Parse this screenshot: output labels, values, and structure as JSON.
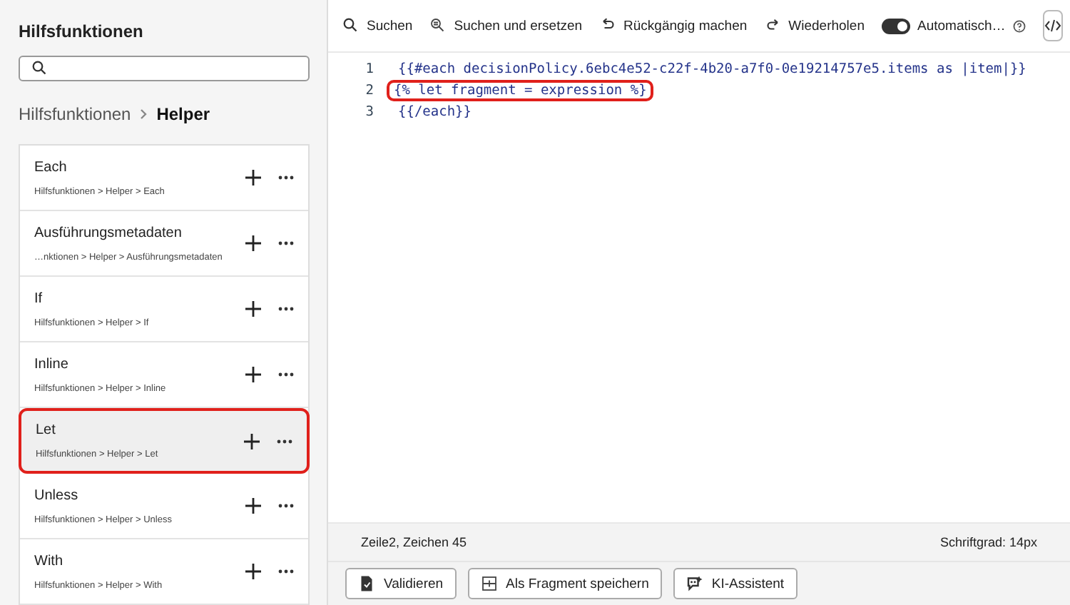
{
  "sidebar": {
    "title": "Hilfsfunktionen",
    "breadcrumb": [
      {
        "label": "Hilfsfunktionen",
        "current": false
      },
      {
        "label": "Helper",
        "current": true
      }
    ],
    "items": [
      {
        "name": "Each",
        "path": "Hilfsfunktionen > Helper > Each",
        "selected": false,
        "highlighted": false
      },
      {
        "name": "Ausführungsmetadaten",
        "path": "…nktionen > Helper > Ausführungsmetadaten",
        "selected": false,
        "highlighted": false
      },
      {
        "name": "If",
        "path": "Hilfsfunktionen > Helper > If",
        "selected": false,
        "highlighted": false
      },
      {
        "name": "Inline",
        "path": "Hilfsfunktionen > Helper > Inline",
        "selected": false,
        "highlighted": false
      },
      {
        "name": "Let",
        "path": "Hilfsfunktionen > Helper > Let",
        "selected": true,
        "highlighted": true
      },
      {
        "name": "Unless",
        "path": "Hilfsfunktionen > Helper > Unless",
        "selected": false,
        "highlighted": false
      },
      {
        "name": "With",
        "path": "Hilfsfunktionen > Helper > With",
        "selected": false,
        "highlighted": false
      }
    ]
  },
  "toolbar": [
    {
      "kind": "search",
      "label": "Suchen"
    },
    {
      "kind": "replace",
      "label": "Suchen und ersetzen"
    },
    {
      "kind": "undo",
      "label": "Rückgängig machen"
    },
    {
      "kind": "redo",
      "label": "Wiederholen"
    },
    {
      "kind": "toggle",
      "label": "Automatisch…",
      "on": true
    }
  ],
  "editor": {
    "lines": [
      {
        "number": "1",
        "code": "{{#each decisionPolicy.6ebc4e52-c22f-4b20-a7f0-0e19214757e5.items as |item|}}",
        "highlighted": false
      },
      {
        "number": "2",
        "code": "{% let fragment = expression %}",
        "highlighted": true
      },
      {
        "number": "3",
        "code": "{{/each}}",
        "highlighted": false
      }
    ]
  },
  "status_bar": {
    "position": "Zeile2, Zeichen 45",
    "font_size": "Schriftgrad: 14px"
  },
  "buttons": [
    {
      "kind": "validate",
      "label": "Validieren"
    },
    {
      "kind": "fragment",
      "label": "Als Fragment speichern"
    },
    {
      "kind": "ai",
      "label": "KI-Assistent"
    }
  ]
}
